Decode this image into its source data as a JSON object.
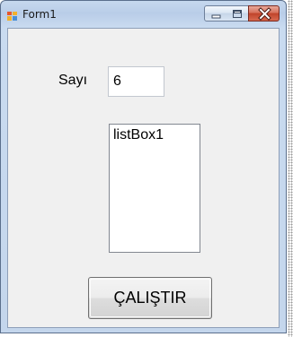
{
  "window": {
    "title": "Form1"
  },
  "form": {
    "sayi_label": "Sayı",
    "sayi_value": "6",
    "listbox_items": [
      "listBox1"
    ],
    "run_button_label": "ÇALIŞTIR"
  },
  "icons": {
    "app": "form-app-icon",
    "minimize": "minimize-icon",
    "maximize": "maximize-icon",
    "close": "close-icon"
  }
}
